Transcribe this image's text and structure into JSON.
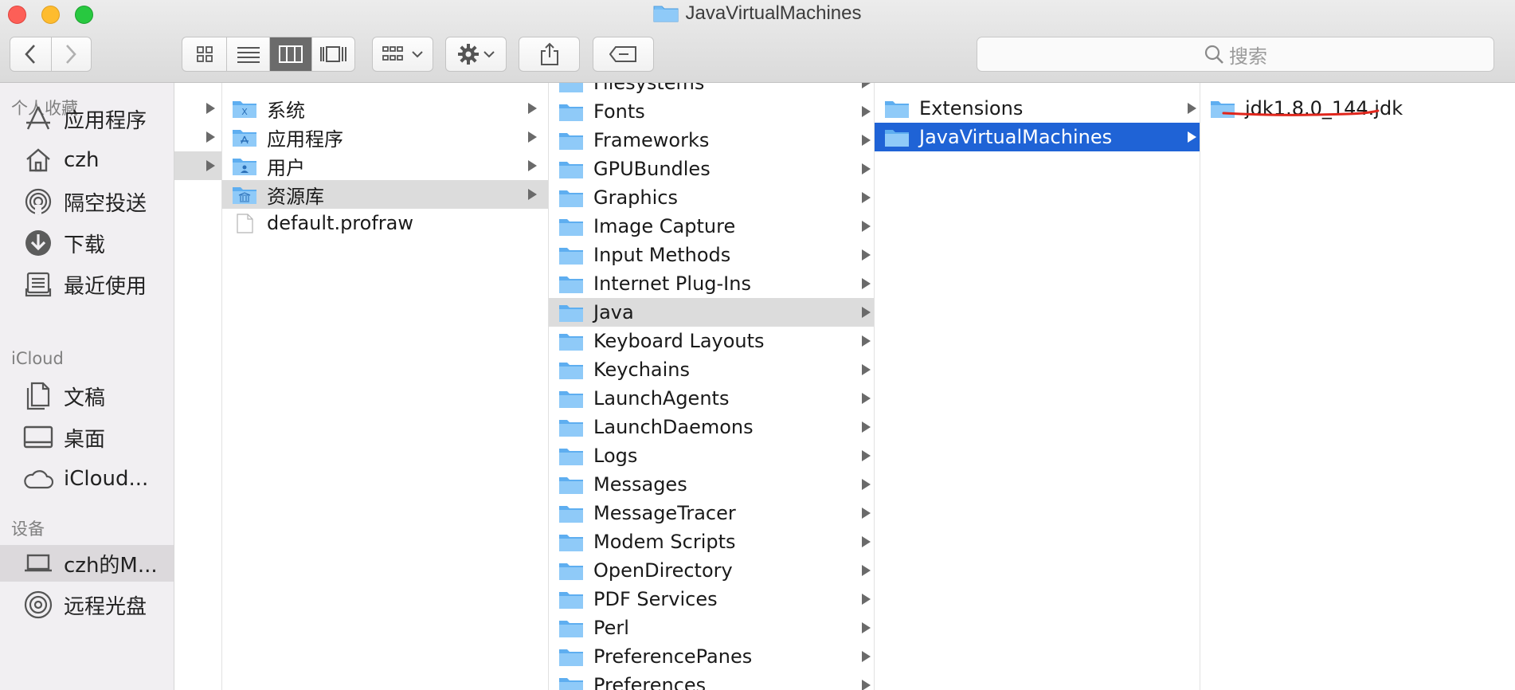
{
  "window": {
    "title": "JavaVirtualMachines",
    "traffic_lights": [
      "close",
      "minimize",
      "maximize"
    ]
  },
  "toolbar": {
    "back_icon": "chevron-left-icon",
    "forward_icon": "chevron-right-icon",
    "view_modes": [
      "icon-view",
      "list-view",
      "column-view",
      "gallery-view"
    ],
    "active_view": "column-view",
    "group_icon": "group-by-icon",
    "action_icon": "gear-icon",
    "share_icon": "share-icon",
    "tag_icon": "tag-icon",
    "search_placeholder": "搜索"
  },
  "sidebar": {
    "sections": [
      {
        "title": "个人收藏",
        "items": [
          {
            "label": "应用程序",
            "icon": "applications-icon"
          },
          {
            "label": "czh",
            "icon": "home-icon"
          },
          {
            "label": "隔空投送",
            "icon": "airdrop-icon"
          },
          {
            "label": "下载",
            "icon": "download-icon"
          },
          {
            "label": "最近使用",
            "icon": "recents-icon"
          }
        ]
      },
      {
        "title": "iCloud",
        "items": [
          {
            "label": "文稿",
            "icon": "documents-icon"
          },
          {
            "label": "桌面",
            "icon": "desktop-icon"
          },
          {
            "label": "iCloud...",
            "icon": "cloud-icon"
          }
        ]
      },
      {
        "title": "设备",
        "items": [
          {
            "label": "czh的M...",
            "icon": "laptop-icon",
            "selected": true
          },
          {
            "label": "远程光盘",
            "icon": "disc-icon"
          }
        ]
      }
    ]
  },
  "columns": {
    "col1": {
      "items": [
        {
          "label": "系统",
          "icon": "system-folder-icon",
          "arrow": true
        },
        {
          "label": "应用程序",
          "icon": "applications-folder-icon",
          "arrow": true
        },
        {
          "label": "用户",
          "icon": "users-folder-icon",
          "arrow": true
        },
        {
          "label": "资源库",
          "icon": "library-folder-icon",
          "arrow": true,
          "selected": true
        },
        {
          "label": "default.profraw",
          "icon": "file-icon",
          "arrow": false
        }
      ]
    },
    "col2": {
      "items": [
        {
          "label": "Filesystems"
        },
        {
          "label": "Fonts"
        },
        {
          "label": "Frameworks"
        },
        {
          "label": "GPUBundles"
        },
        {
          "label": "Graphics"
        },
        {
          "label": "Image Capture"
        },
        {
          "label": "Input Methods"
        },
        {
          "label": "Internet Plug-Ins"
        },
        {
          "label": "Java",
          "selected": true
        },
        {
          "label": "Keyboard Layouts"
        },
        {
          "label": "Keychains"
        },
        {
          "label": "LaunchAgents"
        },
        {
          "label": "LaunchDaemons"
        },
        {
          "label": "Logs"
        },
        {
          "label": "Messages"
        },
        {
          "label": "MessageTracer"
        },
        {
          "label": "Modem Scripts"
        },
        {
          "label": "OpenDirectory"
        },
        {
          "label": "PDF Services"
        },
        {
          "label": "Perl"
        },
        {
          "label": "PreferencePanes"
        },
        {
          "label": "Preferences"
        }
      ]
    },
    "col3": {
      "items": [
        {
          "label": "Extensions"
        },
        {
          "label": "JavaVirtualMachines",
          "selected": true
        }
      ]
    },
    "col4": {
      "items": [
        {
          "label": "jdk1.8.0_144.jdk",
          "underlined": true
        }
      ]
    }
  },
  "colors": {
    "selection_blue": "#1f63d6",
    "selection_gray": "#dcdcdc",
    "annotation_red": "#e0261c",
    "folder_blue": "#6cb6f2"
  }
}
